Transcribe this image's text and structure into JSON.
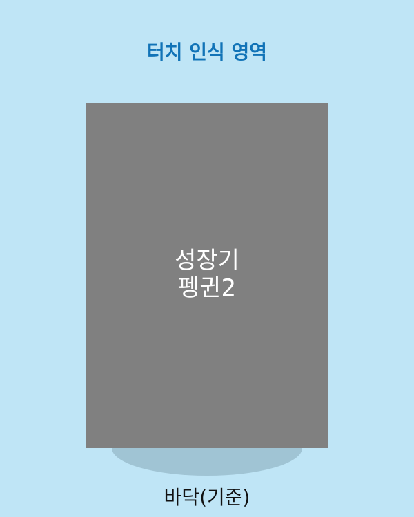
{
  "title": "터치 인식 영역",
  "character": {
    "line1": "성장기",
    "line2": "펭귄2"
  },
  "floor_label": "바닥(기준)",
  "colors": {
    "background": "#bfe5f6",
    "title": "#1173b7",
    "touch_area": "#808080",
    "shadow": "#a0c4d4"
  }
}
